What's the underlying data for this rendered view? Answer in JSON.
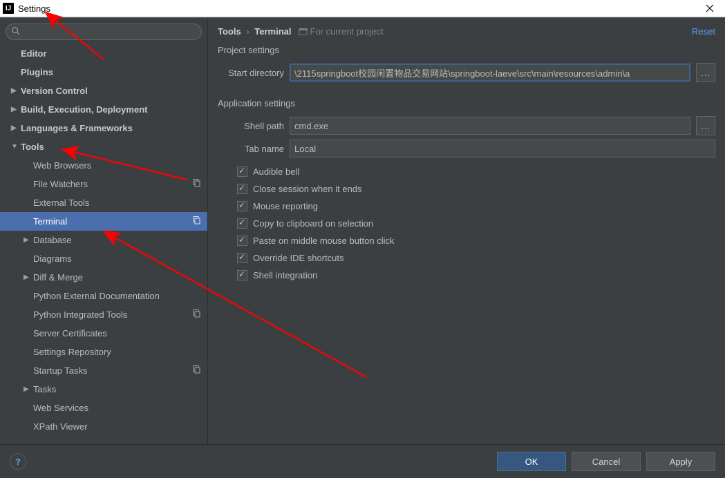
{
  "window": {
    "title": "Settings"
  },
  "breadcrumb": {
    "root": "Tools",
    "leaf": "Terminal",
    "for_project": "For current project"
  },
  "actions": {
    "reset": "Reset"
  },
  "sidebar": {
    "items": [
      {
        "label": "Editor",
        "type": "root",
        "caret": false
      },
      {
        "label": "Plugins",
        "type": "root",
        "caret": false
      },
      {
        "label": "Version Control",
        "type": "root",
        "caret": true
      },
      {
        "label": "Build, Execution, Deployment",
        "type": "root",
        "caret": true
      },
      {
        "label": "Languages & Frameworks",
        "type": "root",
        "caret": true
      },
      {
        "label": "Tools",
        "type": "root",
        "caret": true,
        "expanded": true
      },
      {
        "label": "Web Browsers",
        "type": "child"
      },
      {
        "label": "File Watchers",
        "type": "child",
        "badge": true
      },
      {
        "label": "External Tools",
        "type": "child"
      },
      {
        "label": "Terminal",
        "type": "child",
        "selected": true,
        "badge": true
      },
      {
        "label": "Database",
        "type": "child",
        "caret": true
      },
      {
        "label": "Diagrams",
        "type": "child"
      },
      {
        "label": "Diff & Merge",
        "type": "child",
        "caret": true
      },
      {
        "label": "Python External Documentation",
        "type": "child"
      },
      {
        "label": "Python Integrated Tools",
        "type": "child",
        "badge": true
      },
      {
        "label": "Server Certificates",
        "type": "child"
      },
      {
        "label": "Settings Repository",
        "type": "child"
      },
      {
        "label": "Startup Tasks",
        "type": "child",
        "badge": true
      },
      {
        "label": "Tasks",
        "type": "child",
        "caret": true
      },
      {
        "label": "Web Services",
        "type": "child"
      },
      {
        "label": "XPath Viewer",
        "type": "child"
      }
    ]
  },
  "sections": {
    "project": "Project settings",
    "application": "Application settings"
  },
  "form": {
    "start_directory_label": "Start directory",
    "start_directory_value": "\\2115springboot校园闲置物品交易网站\\springboot-laeve\\src\\main\\resources\\admin\\a",
    "shell_path_label": "Shell path",
    "shell_path_value": "cmd.exe",
    "tab_name_label": "Tab name",
    "tab_name_value": "Local",
    "browse": "..."
  },
  "checks": [
    "Audible bell",
    "Close session when it ends",
    "Mouse reporting",
    "Copy to clipboard on selection",
    "Paste on middle mouse button click",
    "Override IDE shortcuts",
    "Shell integration"
  ],
  "footer": {
    "ok": "OK",
    "cancel": "Cancel",
    "apply": "Apply"
  }
}
